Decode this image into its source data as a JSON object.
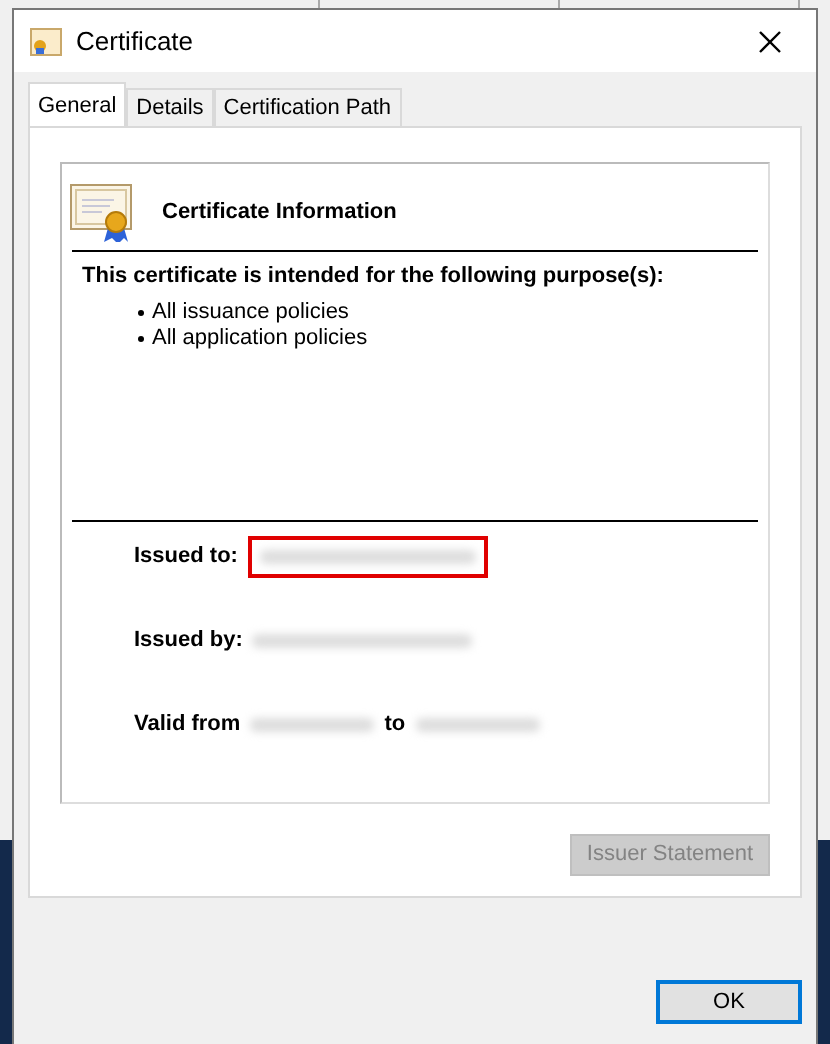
{
  "dialog": {
    "title": "Certificate",
    "tabs": [
      {
        "label": "General",
        "selected": true
      },
      {
        "label": "Details",
        "selected": false
      },
      {
        "label": "Certification Path",
        "selected": false
      }
    ],
    "info_title": "Certificate Information",
    "purpose_heading": "This certificate is intended for the following purpose(s):",
    "purposes": [
      "All issuance policies",
      "All application policies"
    ],
    "fields": [
      {
        "label": "Issued to:",
        "highlighted": true
      },
      {
        "label": "Issued by:",
        "highlighted": false
      }
    ],
    "validity": {
      "from_label": "Valid from",
      "to_label": "to"
    },
    "buttons": [
      {
        "label": "Issuer Statement",
        "disabled": true,
        "default": false
      },
      {
        "label": "OK",
        "disabled": false,
        "default": true
      }
    ]
  }
}
